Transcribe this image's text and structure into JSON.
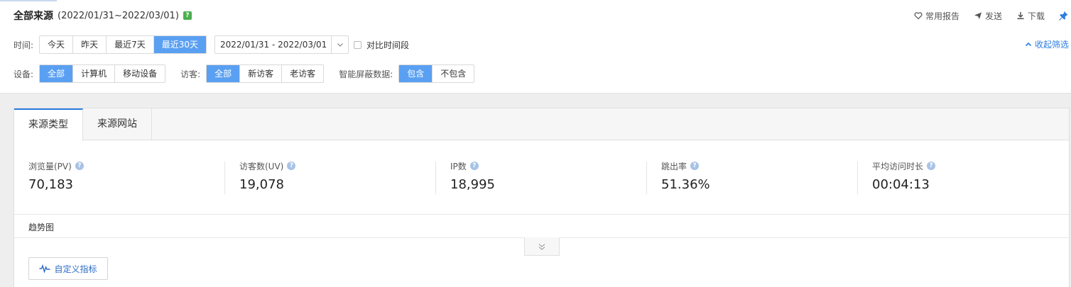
{
  "header": {
    "title": "全部来源",
    "range": "(2022/01/31~2022/03/01)",
    "help": "?",
    "actions": [
      {
        "label": "常用报告",
        "icon": "heart-icon"
      },
      {
        "label": "发送",
        "icon": "send-icon"
      },
      {
        "label": "下载",
        "icon": "download-icon"
      }
    ]
  },
  "filters": {
    "time": {
      "label": "时间:",
      "options": [
        "今天",
        "昨天",
        "最近7天",
        "最近30天"
      ],
      "selected": "最近30天",
      "date_value": "2022/01/31 - 2022/03/01",
      "compare_label": "对比时间段"
    },
    "collapse_label": "收起筛选",
    "device": {
      "label": "设备:",
      "options": [
        "全部",
        "计算机",
        "移动设备"
      ],
      "selected": "全部"
    },
    "visitor": {
      "label": "访客:",
      "options": [
        "全部",
        "新访客",
        "老访客"
      ],
      "selected": "全部"
    },
    "smart": {
      "label": "智能屏蔽数据:",
      "options": [
        "包含",
        "不包含"
      ],
      "selected": "包含"
    }
  },
  "tabs": [
    {
      "label": "来源类型",
      "active": true
    },
    {
      "label": "来源网站",
      "active": false
    }
  ],
  "metrics": [
    {
      "label": "浏览量(PV)",
      "value": "70,183"
    },
    {
      "label": "访客数(UV)",
      "value": "19,078"
    },
    {
      "label": "IP数",
      "value": "18,995"
    },
    {
      "label": "跳出率",
      "value": "51.36%"
    },
    {
      "label": "平均访问时长",
      "value": "00:04:13"
    }
  ],
  "trend": {
    "title": "趋势图",
    "custom_button": "自定义指标"
  },
  "colors": {
    "accent": "#5aa0f2",
    "link": "#2b7de0",
    "help_green": "#4caf50"
  }
}
